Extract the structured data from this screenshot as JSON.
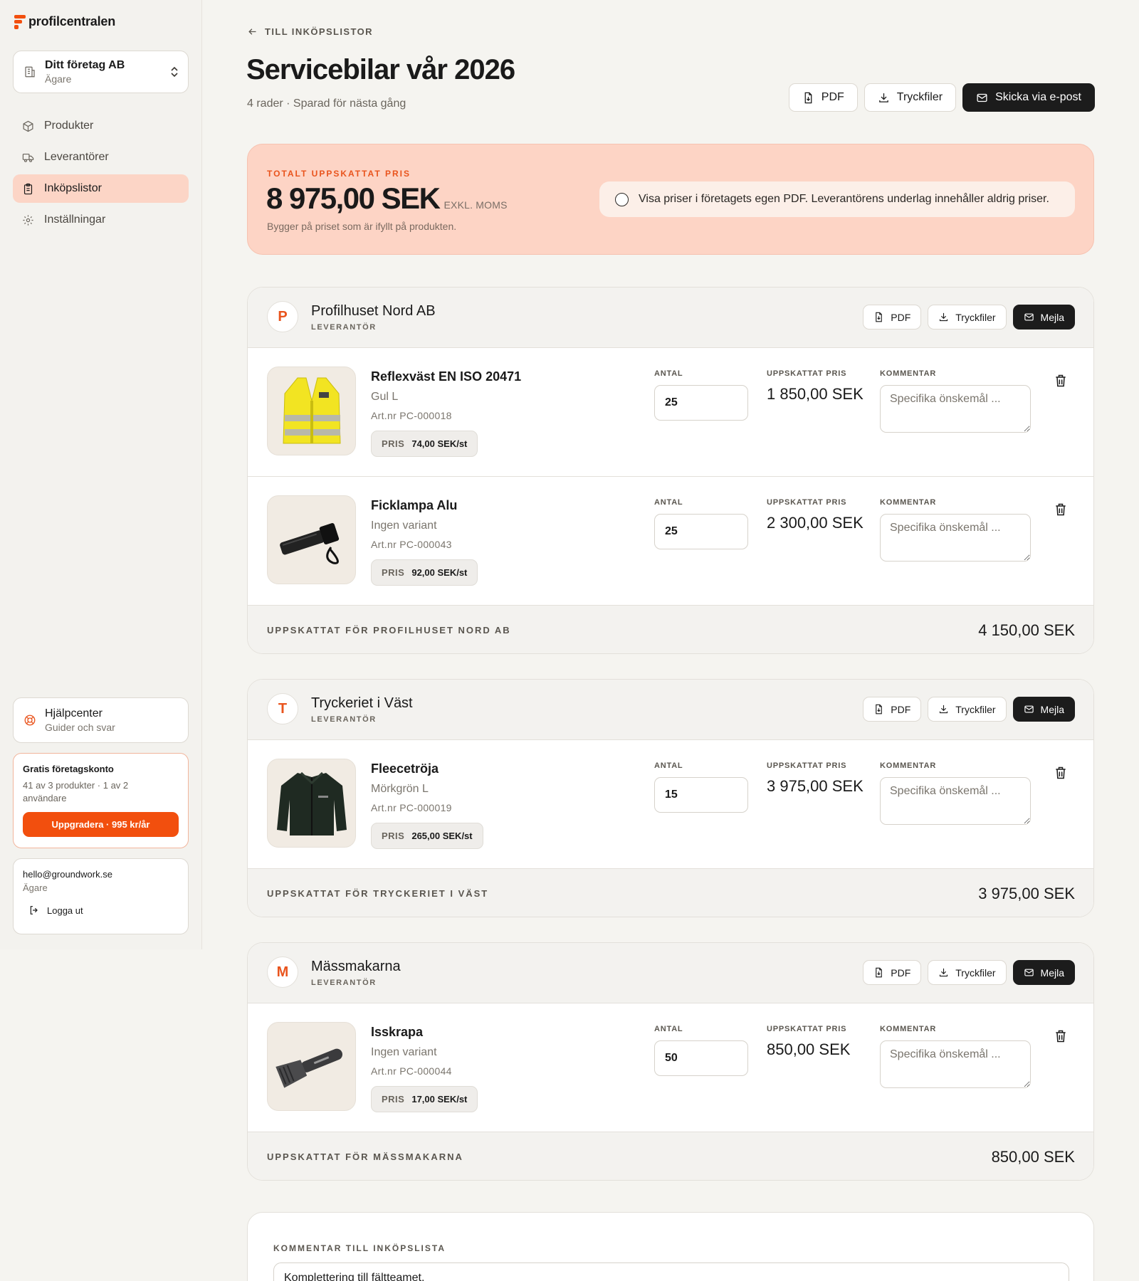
{
  "app": {
    "name": "profilcentralen",
    "accent": "#f24f0e"
  },
  "company": {
    "name": "Ditt företag AB",
    "role": "Ägare"
  },
  "nav": [
    {
      "label": "Produkter",
      "icon": "box-icon",
      "active": false
    },
    {
      "label": "Leverantörer",
      "icon": "truck-icon",
      "active": false
    },
    {
      "label": "Inköpslistor",
      "icon": "clipboard-icon",
      "active": true
    },
    {
      "label": "Inställningar",
      "icon": "gear-icon",
      "active": false
    }
  ],
  "help": {
    "title": "Hjälpcenter",
    "subtitle": "Guider och svar"
  },
  "plan": {
    "title": "Gratis företagskonto",
    "usage": "41 av 3 produkter · 1 av 2 användare",
    "upgrade_label": "Uppgradera · 995 kr/år"
  },
  "account": {
    "email": "hello@groundwork.se",
    "role": "Ägare",
    "logout_label": "Logga ut"
  },
  "header": {
    "back_label": "TILL INKÖPSLISTOR",
    "title": "Servicebilar vår 2026",
    "subtitle": "4 rader · Sparad för nästa gång",
    "pdf_label": "PDF",
    "print_label": "Tryckfiler",
    "email_label": "Skicka via e-post"
  },
  "total": {
    "label": "TOTALT UPPSKATTAT PRIS",
    "amount": "8 975,00 SEK",
    "vat": "EXKL. MOMS",
    "note": "Bygger på priset som är ifyllt på produkten.",
    "toggle_label": "Visa priser i företagets egen PDF. Leverantörens underlag innehåller aldrig priser."
  },
  "labels": {
    "supplier": "LEVERANTÖR",
    "qty": "ANTAL",
    "est": "UPPSKATTAT PRIS",
    "comment": "KOMMENTAR",
    "price": "PRIS",
    "comment_placeholder": "Specifika önskemål ...",
    "pdf": "PDF",
    "print": "Tryckfiler",
    "mail": "Mejla"
  },
  "suppliers": [
    {
      "initial": "P",
      "name": "Profilhuset Nord AB",
      "footer_label": "UPPSKATTAT FÖR PROFILHUSET NORD AB",
      "footer_amount": "4 150,00 SEK",
      "items": [
        {
          "name": "Reflexväst EN ISO 20471",
          "variant": "Gul L",
          "article": "Art.nr PC-000018",
          "unit_price": "74,00 SEK/st",
          "qty": "25",
          "est": "1 850,00 SEK",
          "image": "vest"
        },
        {
          "name": "Ficklampa Alu",
          "variant": "Ingen variant",
          "article": "Art.nr PC-000043",
          "unit_price": "92,00 SEK/st",
          "qty": "25",
          "est": "2 300,00 SEK",
          "image": "flashlight"
        }
      ]
    },
    {
      "initial": "T",
      "name": "Tryckeriet i Väst",
      "footer_label": "UPPSKATTAT FÖR TRYCKERIET I VÄST",
      "footer_amount": "3 975,00 SEK",
      "items": [
        {
          "name": "Fleecetröja",
          "variant": "Mörkgrön L",
          "article": "Art.nr PC-000019",
          "unit_price": "265,00 SEK/st",
          "qty": "15",
          "est": "3 975,00 SEK",
          "image": "fleece"
        }
      ]
    },
    {
      "initial": "M",
      "name": "Mässmakarna",
      "footer_label": "UPPSKATTAT FÖR MÄSSMAKARNA",
      "footer_amount": "850,00 SEK",
      "items": [
        {
          "name": "Isskrapa",
          "variant": "Ingen variant",
          "article": "Art.nr PC-000044",
          "unit_price": "17,00 SEK/st",
          "qty": "50",
          "est": "850,00 SEK",
          "image": "scraper"
        }
      ]
    }
  ],
  "list_comment": {
    "label": "KOMMENTAR TILL INKÖPSLISTA",
    "value": "Komplettering till fältteamet."
  }
}
